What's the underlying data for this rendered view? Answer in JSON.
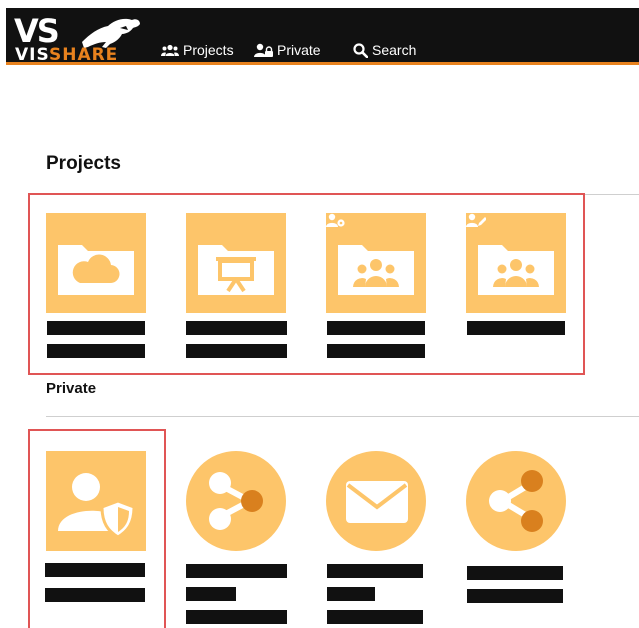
{
  "app": {
    "logo_top": "VS",
    "brand_part1": "VIS",
    "brand_part2": "SHARE"
  },
  "nav": {
    "projects": "Projects",
    "private": "Private",
    "search": "Search"
  },
  "sections": {
    "projects_title": "Projects",
    "private_title": "Private"
  },
  "projects_tiles": [
    {
      "icon": "cloud-folder-icon"
    },
    {
      "icon": "presentation-folder-icon"
    },
    {
      "icon": "group-folder-icon",
      "badge": "user-settings-icon"
    },
    {
      "icon": "group-folder-icon",
      "badge": "user-edit-icon"
    }
  ],
  "private_tiles": [
    {
      "icon": "user-shield-icon"
    },
    {
      "icon": "share-icon"
    },
    {
      "icon": "mail-icon"
    },
    {
      "icon": "share-icon"
    }
  ],
  "colors": {
    "header_bg": "#111111",
    "accent": "#e8821e",
    "tile_bg": "#fdc56a",
    "tile_fg": "#ffffff",
    "tile_node": "#d9801e",
    "highlight": "#e05555",
    "redaction": "#111111"
  }
}
